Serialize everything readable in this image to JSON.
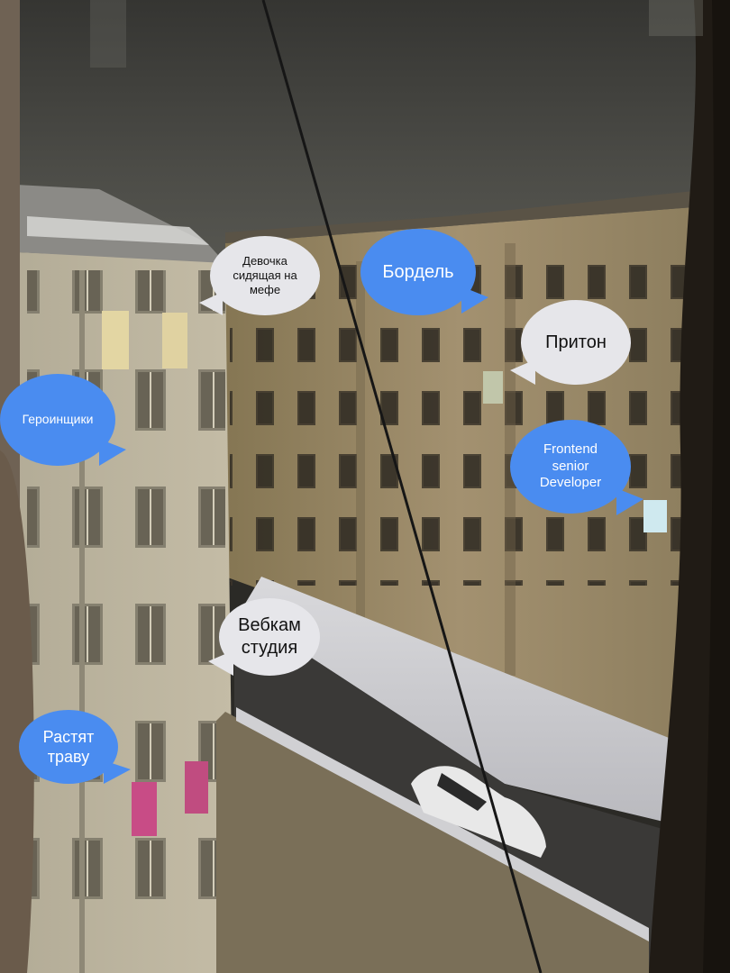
{
  "bubbles": {
    "devochka": {
      "text": "Девочка\nсидящая на\nмефе",
      "color": "gray"
    },
    "bordel": {
      "text": "Бордель",
      "color": "blue"
    },
    "priton": {
      "text": "Притон",
      "color": "gray"
    },
    "geroinshchiki": {
      "text": "Героинщики",
      "color": "blue"
    },
    "frontend": {
      "text": "Frontend\nsenior\nDeveloper",
      "color": "blue"
    },
    "vebkam": {
      "text": "Вебкам\nстудия",
      "color": "gray"
    },
    "rastyat": {
      "text": "Растят\nтраву",
      "color": "blue"
    }
  },
  "colors": {
    "bubble_blue": "#4a8cf0",
    "bubble_gray": "#e6e6ea",
    "sky": "#4a4a45",
    "facade": "#9a8a64"
  }
}
